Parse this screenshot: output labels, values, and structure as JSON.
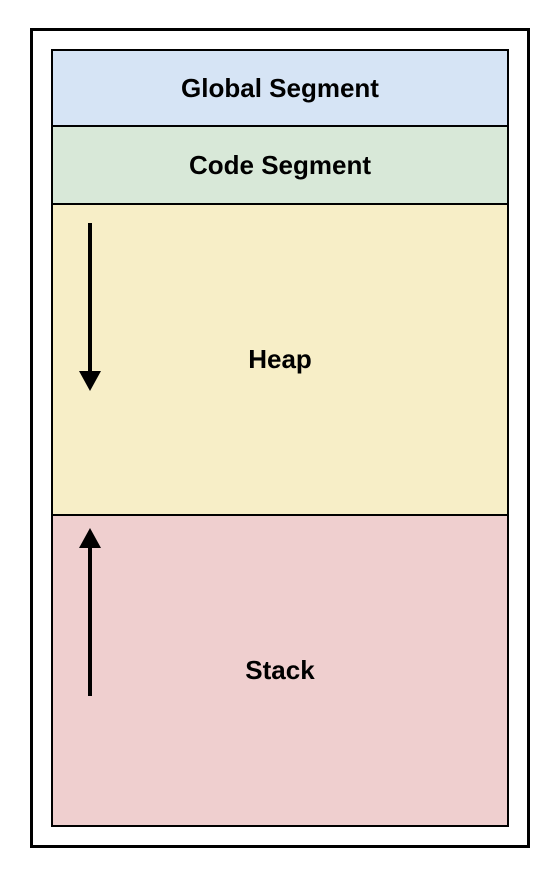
{
  "segments": {
    "global": {
      "label": "Global Segment",
      "color": "#d6e4f5"
    },
    "code": {
      "label": "Code Segment",
      "color": "#d8e8d8"
    },
    "heap": {
      "label": "Heap",
      "color": "#f7eec7",
      "growth_direction": "down"
    },
    "stack": {
      "label": "Stack",
      "color": "#efcfcf",
      "growth_direction": "up"
    }
  }
}
